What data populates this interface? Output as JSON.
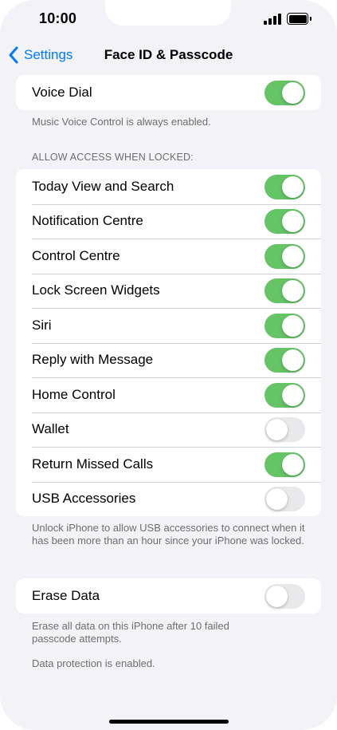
{
  "status_bar": {
    "time": "10:00"
  },
  "nav": {
    "back_label": "Settings",
    "title": "Face ID & Passcode"
  },
  "voice_dial": {
    "label": "Voice Dial",
    "on": true,
    "footer": "Music Voice Control is always enabled."
  },
  "locked_access": {
    "header": "ALLOW ACCESS WHEN LOCKED:",
    "items": [
      {
        "label": "Today View and Search",
        "on": true
      },
      {
        "label": "Notification Centre",
        "on": true
      },
      {
        "label": "Control Centre",
        "on": true
      },
      {
        "label": "Lock Screen Widgets",
        "on": true
      },
      {
        "label": "Siri",
        "on": true
      },
      {
        "label": "Reply with Message",
        "on": true
      },
      {
        "label": "Home Control",
        "on": true
      },
      {
        "label": "Wallet",
        "on": false
      },
      {
        "label": "Return Missed Calls",
        "on": true
      },
      {
        "label": "USB Accessories",
        "on": false
      }
    ],
    "footer": "Unlock iPhone to allow USB accessories to connect when it has been more than an hour since your iPhone was locked."
  },
  "erase_data": {
    "label": "Erase Data",
    "on": false,
    "footer_line1": "Erase all data on this iPhone after 10 failed passcode attempts.",
    "footer_line2": "Data protection is enabled."
  },
  "colors": {
    "accent": "#007aff",
    "toggle_on": "#65c466",
    "toggle_off": "#e9e9eb",
    "background": "#f2f2f7"
  },
  "icons": {
    "back": "chevron-left-icon",
    "signal": "cellular-signal-icon",
    "battery": "battery-icon"
  }
}
